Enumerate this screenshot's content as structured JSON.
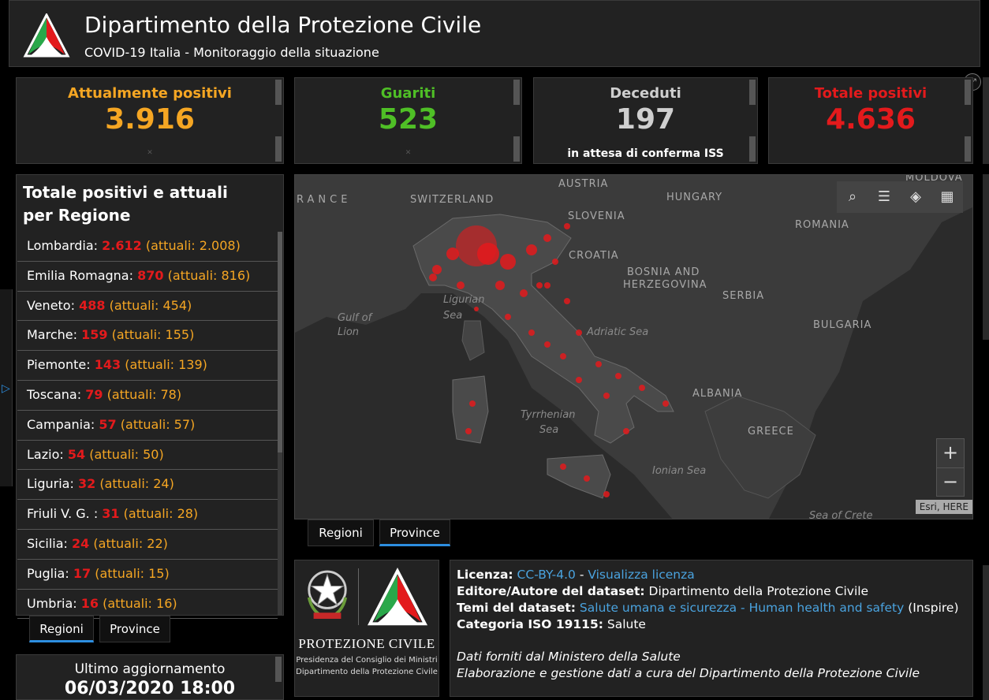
{
  "header": {
    "title": "Dipartimento della Protezione Civile",
    "subtitle": "COVID-19 Italia - Monitoraggio della situazione"
  },
  "colors": {
    "orange": "#f5a623",
    "green": "#4fbf26",
    "red": "#e31a1c",
    "gray": "#cfcfcf",
    "accent_blue": "#2d8ee0"
  },
  "stats": {
    "attuali": {
      "label": "Attualmente positivi",
      "value": "3.916"
    },
    "guariti": {
      "label": "Guariti",
      "value": "523"
    },
    "deceduti": {
      "label": "Deceduti",
      "value": "197",
      "note": "in attesa di conferma ISS"
    },
    "totale": {
      "label": "Totale positivi",
      "value": "4.636"
    }
  },
  "regions": {
    "title": "Totale positivi e attuali per Regione",
    "actual_prefix": "(attuali: ",
    "actual_suffix": ")",
    "items": [
      {
        "name": "Lombardia",
        "total": "2.612",
        "actual": "2.008"
      },
      {
        "name": "Emilia Romagna",
        "total": "870",
        "actual": "816"
      },
      {
        "name": "Veneto",
        "total": "488",
        "actual": "454"
      },
      {
        "name": "Marche",
        "total": "159",
        "actual": "155"
      },
      {
        "name": "Piemonte",
        "total": "143",
        "actual": "139"
      },
      {
        "name": "Toscana",
        "total": "79",
        "actual": "78"
      },
      {
        "name": "Campania",
        "total": "57",
        "actual": "57"
      },
      {
        "name": "Lazio",
        "total": "54",
        "actual": "50"
      },
      {
        "name": "Liguria",
        "total": "32",
        "actual": "24"
      },
      {
        "name": "Friuli V. G. ",
        "total": "31",
        "actual": "28"
      },
      {
        "name": "Sicilia",
        "total": "24",
        "actual": "22"
      },
      {
        "name": "Puglia",
        "total": "17",
        "actual": "15"
      },
      {
        "name": "Umbria",
        "total": "16",
        "actual": "16"
      }
    ]
  },
  "tabs": {
    "regioni": "Regioni",
    "province": "Province"
  },
  "update": {
    "label": "Ultimo aggiornamento",
    "value": "06/03/2020 18:00"
  },
  "map": {
    "labels": {
      "france": "RANCE",
      "switzerland": "SWITZERLAND",
      "austria": "AUSTRIA",
      "hungary": "HUNGARY",
      "slovenia": "SLOVENIA",
      "croatia": "CROATIA",
      "romania": "ROMANIA",
      "moldova": "MOLDOVA",
      "bosnia1": "BOSNIA AND",
      "bosnia2": "HERZEGOVINA",
      "serbia": "SERBIA",
      "bulgaria": "BULGARIA",
      "albania": "ALBANIA",
      "greece": "GREECE",
      "ligurian1": "Ligurian",
      "ligurian2": "Sea",
      "gulf1": "Gulf of",
      "gulf2": "Lion",
      "adriatic": "Adriatic Sea",
      "tyrrhenian1": "Tyrrhenian",
      "tyrrhenian2": "Sea",
      "ionian": "Ionian Sea",
      "crete": "Sea of Crete"
    },
    "attribution": "Esri, HERE",
    "zoom_in": "+",
    "zoom_out": "−",
    "icons": [
      "search-icon",
      "list-icon",
      "layers-icon",
      "basemap-gallery-icon"
    ]
  },
  "logo_panel": {
    "name": "PROTEZIONE CIVILE",
    "line1": "Presidenza del Consiglio dei Ministri",
    "line2": "Dipartimento della Protezione Civile"
  },
  "license": {
    "licenza_label": "Licenza:",
    "licenza_link1": "CC-BY-4.0",
    "licenza_sep": " - ",
    "licenza_link2": "Visualizza licenza",
    "editore_label": "Editore/Autore del dataset:",
    "editore_value": " Dipartimento della Protezione Civile",
    "temi_label": "Temi del dataset:",
    "temi_link": "Salute umana e sicurezza - Human health and safety",
    "temi_suffix": " (Inspire)",
    "iso_label": "Categoria ISO 19115:",
    "iso_value": " Salute",
    "note1": "Dati forniti dal Ministero della Salute",
    "note2": "Elaborazione e gestione dati a cura del Dipartimento della Protezione Civile"
  }
}
